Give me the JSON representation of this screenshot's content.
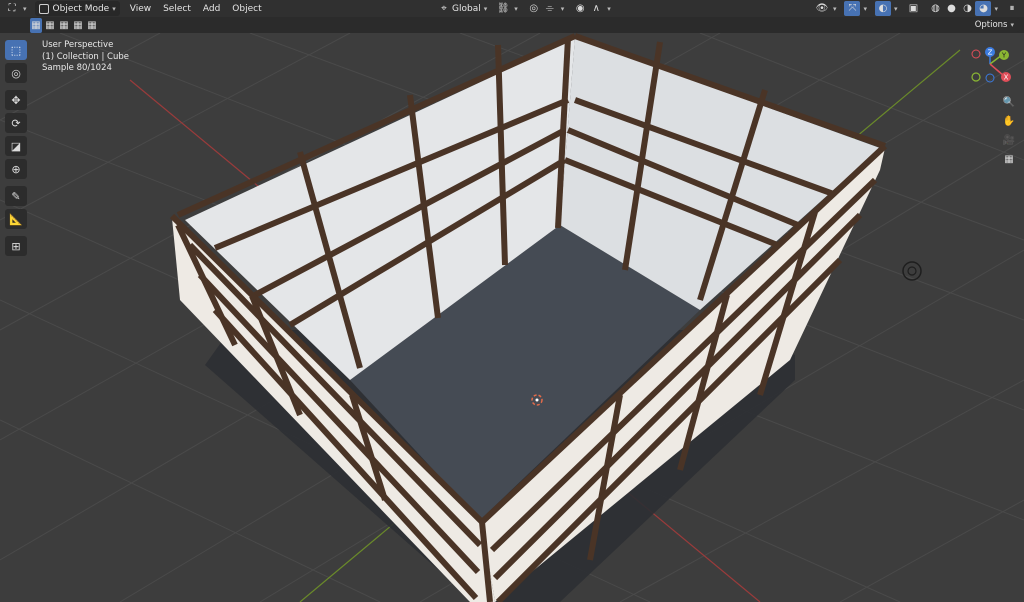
{
  "header": {
    "editor_icon": "editor-type-icon",
    "mode_label": "Object Mode",
    "menus": [
      "View",
      "Select",
      "Add",
      "Object"
    ],
    "transform_orientation": "Global"
  },
  "subheader": {
    "options_label": "Options"
  },
  "viewport": {
    "info": {
      "line1": "User Perspective",
      "line2": "(1) Collection | Cube",
      "line3": "Sample 80/1024"
    },
    "gizmo": {
      "x_label": "X",
      "y_label": "Y",
      "z_label": "Z",
      "x_color": "#e04e59",
      "y_color": "#8bb733",
      "z_color": "#3b7be0"
    }
  },
  "colors": {
    "header_bg": "#303030",
    "viewport_bg": "#3d3d3d",
    "accent": "#4772b3",
    "wood": "#4a3426",
    "panel": "#eeeae4",
    "floor": "#444a52"
  },
  "toolbar": {
    "tools": [
      "select-box-icon",
      "cursor-icon",
      "move-icon",
      "rotate-icon",
      "scale-icon",
      "transform-icon",
      "annotate-icon",
      "measure-icon",
      "add-cube-icon"
    ]
  }
}
